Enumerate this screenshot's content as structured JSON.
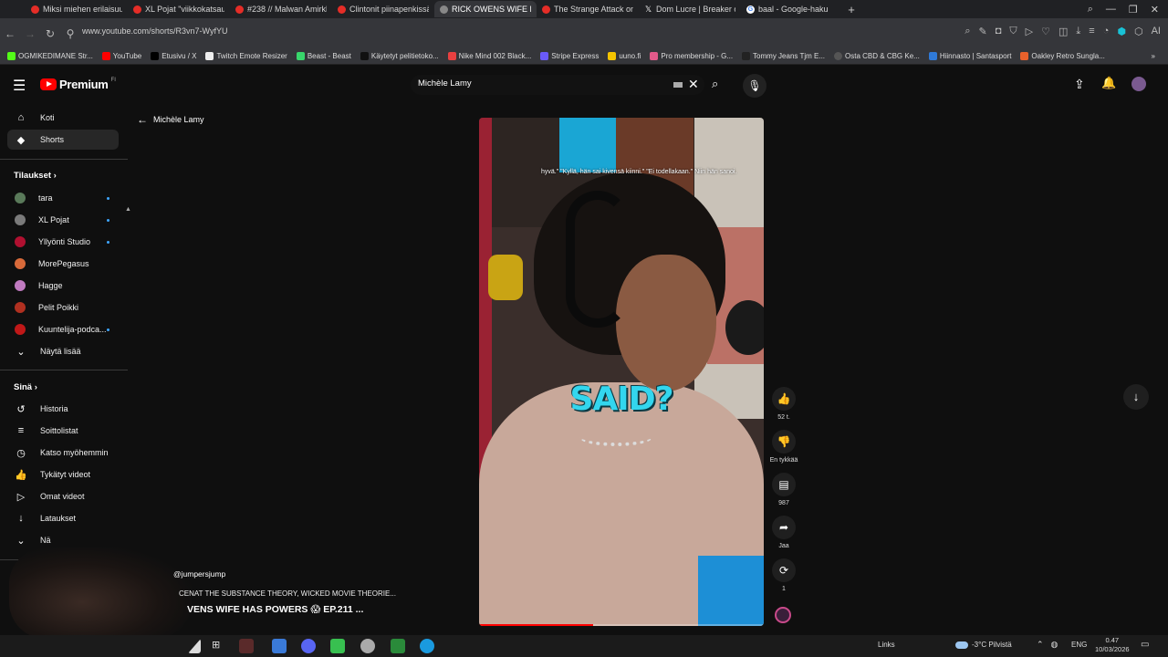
{
  "browser": {
    "tabs": [
      {
        "title": "Miksi miehen erilaisuus ko"
      },
      {
        "title": "XL Pojat \"viikkokatsaus\" E"
      },
      {
        "title": "#238 // Malwan Amirkha"
      },
      {
        "title": "Clintonit piinapenkissä | H"
      },
      {
        "title": "RICK OWENS WIFE HA"
      },
      {
        "title": "The Strange Attack on Flig"
      },
      {
        "title": "Dom Lucre | Breaker of Ne"
      },
      {
        "title": "baal - Google-haku"
      }
    ],
    "url": "www.youtube.com/shorts/R3vn7-WyfYU",
    "bookmarks": [
      "OGMIKEDIMANE Str...",
      "YouTube",
      "Etusivu / X",
      "Twitch Emote Resizer",
      "Beast - Beast",
      "Käytetyt pelitietoko...",
      "Nike Mind 002 Black...",
      "Stripe Express",
      "uuno.fi",
      "Pro membership - G...",
      "Tommy Jeans Tjm E...",
      "Osta CBD & CBG Ke...",
      "Hiinnasto | Santasport",
      "Oakley Retro Sungla..."
    ]
  },
  "header": {
    "logo_text": "Premium",
    "logo_sup": "FI",
    "search_value": "Michèle Lamy"
  },
  "sidebar": {
    "home": "Koti",
    "shorts": "Shorts",
    "subs_heading": "Tilaukset",
    "subscriptions": [
      {
        "name": "tara",
        "color": "#5a7a5a"
      },
      {
        "name": "XL Pojat",
        "color": "#7a7a7a"
      },
      {
        "name": "Yllyönti Studio",
        "color": "#b01030"
      },
      {
        "name": "MorePegasus",
        "color": "#d86a3a"
      },
      {
        "name": "Hagge",
        "color": "#c07ac0"
      },
      {
        "name": "Pelit Poikki",
        "color": "#b03020"
      },
      {
        "name": "Kuuntelija-podca...",
        "color": "#c01818"
      }
    ],
    "show_more": "Näytä lisää",
    "you_heading": "Sinä",
    "you_items": [
      {
        "label": "Historia",
        "icon": "history-icon"
      },
      {
        "label": "Soittolistat",
        "icon": "playlist-icon"
      },
      {
        "label": "Katso myöhemmin",
        "icon": "clock-icon"
      },
      {
        "label": "Tykätyt videot",
        "icon": "thumbs-up-icon"
      },
      {
        "label": "Omat videot",
        "icon": "play-icon"
      },
      {
        "label": "Lataukset",
        "icon": "download-icon"
      }
    ],
    "more_partial": "Nä"
  },
  "back": {
    "label": "Michèle Lamy"
  },
  "video": {
    "subtitle_text": "hyvä.\" \"Kyllä, hän sai kivensä kiinni.\" \"Ei todellakaan.\" Niin hän sanoi.",
    "caption": "SAID?",
    "progress": 0.4
  },
  "actions": {
    "like_count": "52 t.",
    "dislike_label": "En tykkää",
    "comments_count": "987",
    "share_label": "Jaa",
    "remix_count": "1"
  },
  "overlay": {
    "channel_handle": "@jumpersjump",
    "ticker_line": "CENAT THE SUBSTANCE THEORY, WICKED MOVIE THEORIE...",
    "title_line": "VENS WIFE HAS POWERS 😱 EP.211 ..."
  },
  "taskbar": {
    "links": "Links",
    "weather": "-3°C Pilvistä",
    "lang": "ENG",
    "time": "0.47",
    "date": "10/03/2026"
  }
}
